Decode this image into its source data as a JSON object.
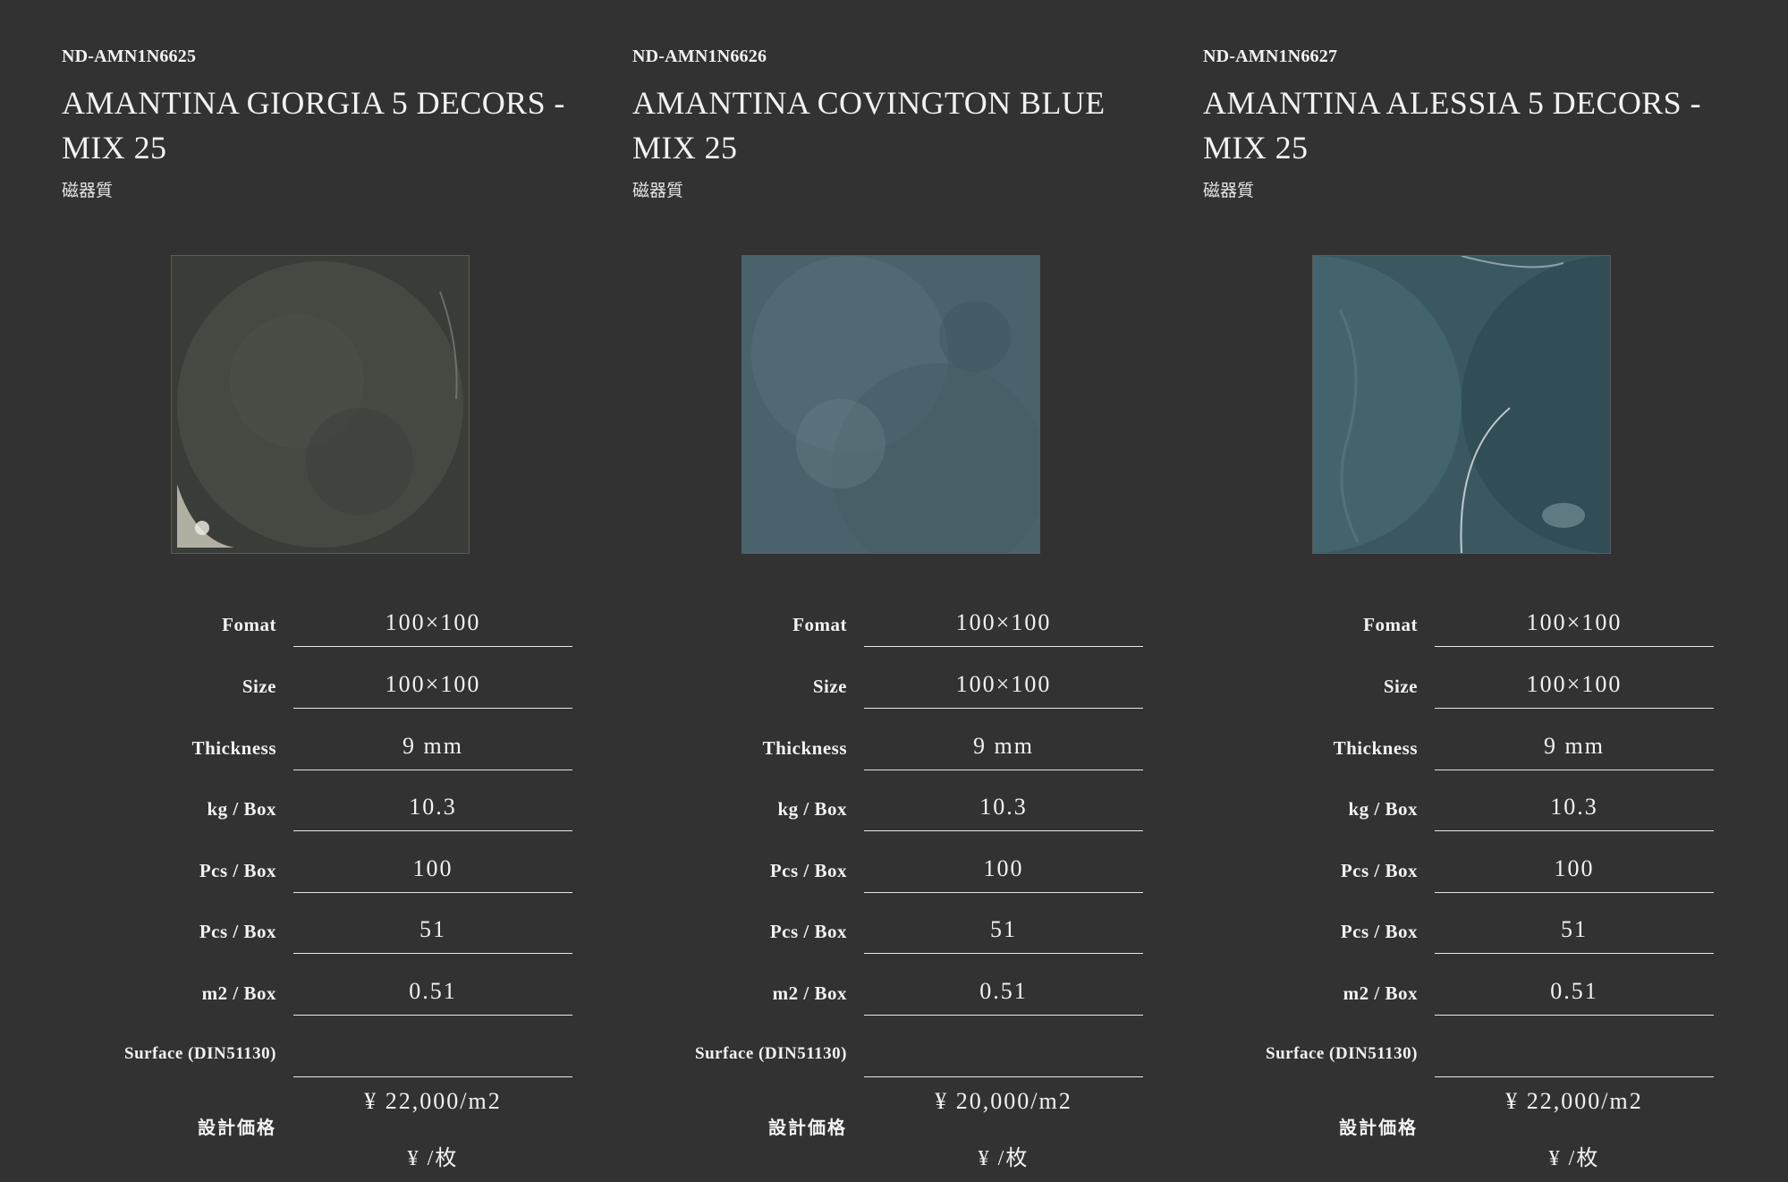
{
  "products": [
    {
      "code": "ND-AMN1N6625",
      "title": "AMANTINA GIORGIA 5 DECORS - MIX 25",
      "material": "磁器質",
      "image_icon": "tile-giorgia-image",
      "specs": [
        {
          "label": "Fomat",
          "value": "100×100"
        },
        {
          "label": "Size",
          "value": "100×100"
        },
        {
          "label": "Thickness",
          "value": "9 mm"
        },
        {
          "label": "kg / Box",
          "value": "10.3"
        },
        {
          "label": "Pcs / Box",
          "value": "100"
        },
        {
          "label": "Pcs / Box",
          "value": "51"
        },
        {
          "label": "m2 / Box",
          "value": "0.51"
        },
        {
          "label": "Surface (DIN51130)",
          "value": ""
        }
      ],
      "price_label": "設計価格",
      "price": "¥ 22,000/m2",
      "per_piece": "¥ /枚"
    },
    {
      "code": "ND-AMN1N6626",
      "title": "AMANTINA COVINGTON BLUE MIX 25",
      "material": "磁器質",
      "image_icon": "tile-covington-image",
      "specs": [
        {
          "label": "Fomat",
          "value": "100×100"
        },
        {
          "label": "Size",
          "value": "100×100"
        },
        {
          "label": "Thickness",
          "value": "9 mm"
        },
        {
          "label": "kg / Box",
          "value": "10.3"
        },
        {
          "label": "Pcs / Box",
          "value": "100"
        },
        {
          "label": "Pcs / Box",
          "value": "51"
        },
        {
          "label": "m2 / Box",
          "value": "0.51"
        },
        {
          "label": "Surface (DIN51130)",
          "value": ""
        }
      ],
      "price_label": "設計価格",
      "price": "¥ 20,000/m2",
      "per_piece": "¥ /枚"
    },
    {
      "code": "ND-AMN1N6627",
      "title": "AMANTINA ALESSIA 5 DECORS - MIX 25",
      "material": "磁器質",
      "image_icon": "tile-alessia-image",
      "specs": [
        {
          "label": "Fomat",
          "value": "100×100"
        },
        {
          "label": "Size",
          "value": "100×100"
        },
        {
          "label": "Thickness",
          "value": "9 mm"
        },
        {
          "label": "kg / Box",
          "value": "10.3"
        },
        {
          "label": "Pcs / Box",
          "value": "100"
        },
        {
          "label": "Pcs / Box",
          "value": "51"
        },
        {
          "label": "m2 / Box",
          "value": "0.51"
        },
        {
          "label": "Surface (DIN51130)",
          "value": ""
        }
      ],
      "price_label": "設計価格",
      "price": "¥ 22,000/m2",
      "per_piece": "¥ /枚"
    }
  ],
  "colors": {
    "background": "#323232",
    "text": "#f2f2f2",
    "tile_giorgia": "#3f413b",
    "tile_covington": "#4d6670",
    "tile_alessia": "#3d5a63"
  }
}
